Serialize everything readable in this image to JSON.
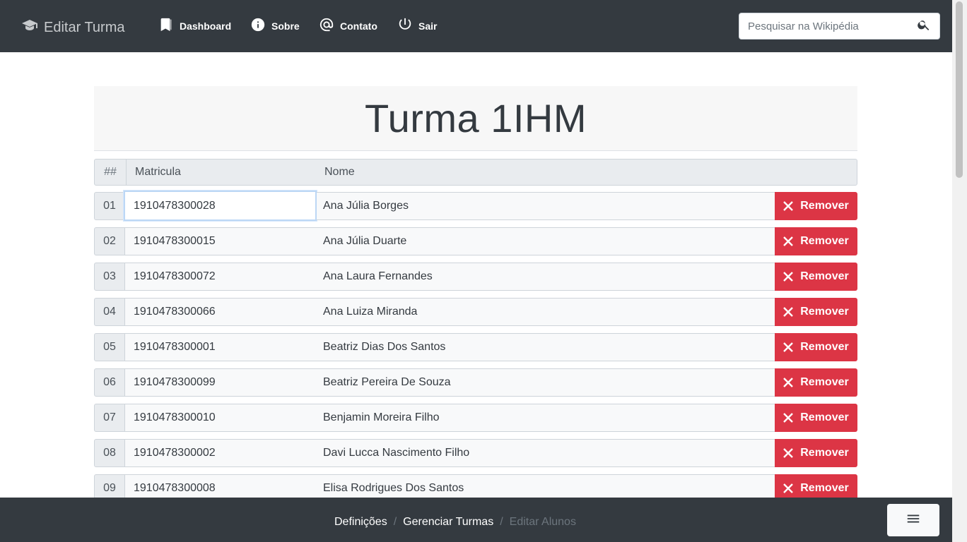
{
  "navbar": {
    "brand": "Editar Turma",
    "brand_icon": "graduation-cap-icon",
    "items": [
      {
        "label": "Dashboard",
        "icon": "bookmark-icon"
      },
      {
        "label": "Sobre",
        "icon": "info-icon"
      },
      {
        "label": "Contato",
        "icon": "at-icon"
      },
      {
        "label": "Sair",
        "icon": "power-icon"
      }
    ],
    "search": {
      "placeholder": "Pesquisar na Wikipédia",
      "value": "",
      "icon": "search-icon"
    }
  },
  "main": {
    "title": "Turma 1IHM",
    "table": {
      "headers": [
        "##",
        "Matricula",
        "Nome"
      ],
      "remove_label": "Remover",
      "rows": [
        {
          "num": "01",
          "matricula": "1910478300028",
          "nome": "Ana Júlia Borges"
        },
        {
          "num": "02",
          "matricula": "1910478300015",
          "nome": "Ana Júlia Duarte"
        },
        {
          "num": "03",
          "matricula": "1910478300072",
          "nome": "Ana Laura Fernandes"
        },
        {
          "num": "04",
          "matricula": "1910478300066",
          "nome": "Ana Luiza Miranda"
        },
        {
          "num": "05",
          "matricula": "1910478300001",
          "nome": "Beatriz Dias Dos Santos"
        },
        {
          "num": "06",
          "matricula": "1910478300099",
          "nome": "Beatriz Pereira De Souza"
        },
        {
          "num": "07",
          "matricula": "1910478300010",
          "nome": "Benjamin Moreira Filho"
        },
        {
          "num": "08",
          "matricula": "1910478300002",
          "nome": "Davi Lucca Nascimento Filho"
        },
        {
          "num": "09",
          "matricula": "1910478300008",
          "nome": "Elisa Rodrigues Dos Santos"
        }
      ]
    }
  },
  "footer": {
    "breadcrumb": [
      "Definições",
      "Gerenciar Turmas",
      "Editar Alunos"
    ],
    "menu_icon": "hamburger-menu-icon"
  },
  "colors": {
    "navbar": "#343a40",
    "danger": "#dc3545",
    "header_bg": "#f7f7f7"
  }
}
